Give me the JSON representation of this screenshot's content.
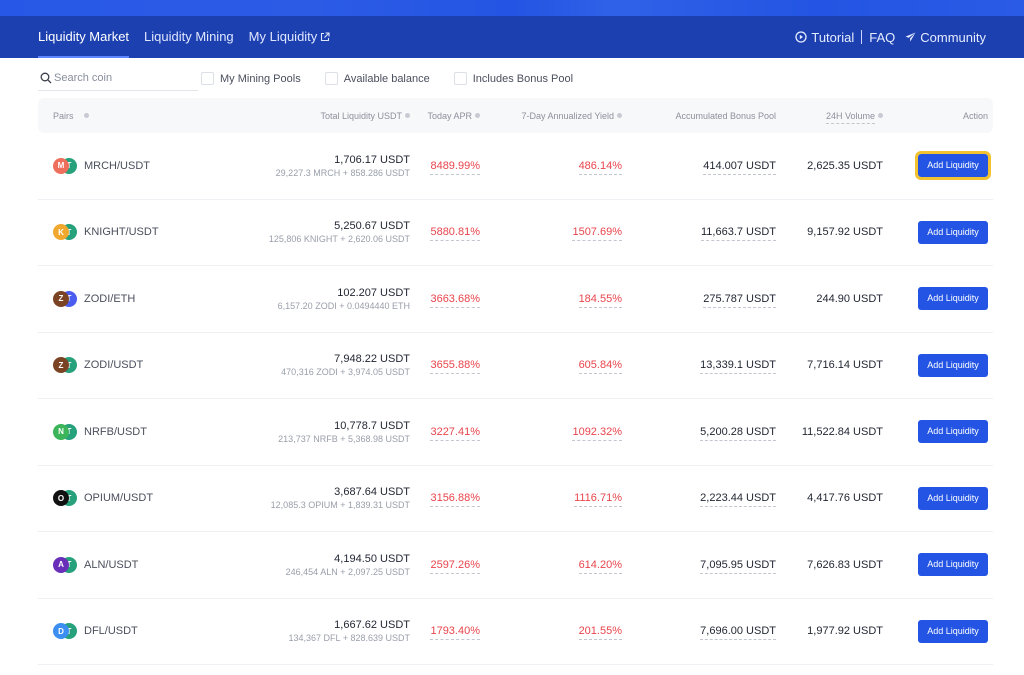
{
  "nav": {
    "items": [
      {
        "label": "Liquidity Market",
        "active": true
      },
      {
        "label": "Liquidity Mining",
        "active": false
      },
      {
        "label": "My Liquidity",
        "active": false,
        "icon": "external-link-icon"
      }
    ],
    "right": {
      "tutorial": "Tutorial",
      "faq": "FAQ",
      "community": "Community"
    }
  },
  "filters": {
    "search_placeholder": "Search coin",
    "search_value": "",
    "checkboxes": [
      {
        "label": "My Mining Pools",
        "checked": false
      },
      {
        "label": "Available balance",
        "checked": false
      },
      {
        "label": "Includes Bonus Pool",
        "checked": false
      }
    ]
  },
  "table": {
    "headers": {
      "pairs": "Pairs",
      "total_liquidity": "Total Liquidity USDT",
      "today_apr": "Today APR",
      "yield7d": "7-Day Annualized Yield",
      "bonus_pool": "Accumulated Bonus Pool",
      "volume24h": "24H Volume",
      "action": "Action"
    },
    "rows": [
      {
        "pair": "MRCH/USDT",
        "base_color": "#ef6f5d",
        "quote_color": "#26a17b",
        "liquidity": "1,706.17 USDT",
        "composition": "29,227.3 MRCH + 858.286 USDT",
        "apr": "8489.99%",
        "yield7d": "486.14%",
        "bonus": "414.007 USDT",
        "volume": "2,625.35 USDT",
        "action": "Add Liquidity",
        "focused": true
      },
      {
        "pair": "KNIGHT/USDT",
        "base_color": "#f0a92e",
        "quote_color": "#26a17b",
        "liquidity": "5,250.67 USDT",
        "composition": "125,806 KNIGHT + 2,620.06 USDT",
        "apr": "5880.81%",
        "yield7d": "1507.69%",
        "bonus": "11,663.7 USDT",
        "volume": "9,157.92 USDT",
        "action": "Add Liquidity",
        "focused": false
      },
      {
        "pair": "ZODI/ETH",
        "base_color": "#7a4424",
        "quote_color": "#4a5df0",
        "liquidity": "102.207 USDT",
        "composition": "6,157.20 ZODI + 0.0494440 ETH",
        "apr": "3663.68%",
        "yield7d": "184.55%",
        "bonus": "275.787 USDT",
        "volume": "244.90 USDT",
        "action": "Add Liquidity",
        "focused": false
      },
      {
        "pair": "ZODI/USDT",
        "base_color": "#7a4424",
        "quote_color": "#26a17b",
        "liquidity": "7,948.22 USDT",
        "composition": "470,316 ZODI + 3,974.05 USDT",
        "apr": "3655.88%",
        "yield7d": "605.84%",
        "bonus": "13,339.1 USDT",
        "volume": "7,716.14 USDT",
        "action": "Add Liquidity",
        "focused": false
      },
      {
        "pair": "NRFB/USDT",
        "base_color": "#3cb45a",
        "quote_color": "#26a17b",
        "liquidity": "10,778.7 USDT",
        "composition": "213,737 NRFB + 5,368.98 USDT",
        "apr": "3227.41%",
        "yield7d": "1092.32%",
        "bonus": "5,200.28 USDT",
        "volume": "11,522.84 USDT",
        "action": "Add Liquidity",
        "focused": false
      },
      {
        "pair": "OPIUM/USDT",
        "base_color": "#111111",
        "quote_color": "#26a17b",
        "liquidity": "3,687.64 USDT",
        "composition": "12,085.3 OPIUM + 1,839.31 USDT",
        "apr": "3156.88%",
        "yield7d": "1116.71%",
        "bonus": "2,223.44 USDT",
        "volume": "4,417.76 USDT",
        "action": "Add Liquidity",
        "focused": false
      },
      {
        "pair": "ALN/USDT",
        "base_color": "#6a2fb8",
        "quote_color": "#26a17b",
        "liquidity": "4,194.50 USDT",
        "composition": "246,454 ALN + 2,097.25 USDT",
        "apr": "2597.26%",
        "yield7d": "614.20%",
        "bonus": "7,095.95 USDT",
        "volume": "7,626.83 USDT",
        "action": "Add Liquidity",
        "focused": false
      },
      {
        "pair": "DFL/USDT",
        "base_color": "#3c8ef0",
        "quote_color": "#26a17b",
        "liquidity": "1,667.62 USDT",
        "composition": "134,367 DFL + 828.639 USDT",
        "apr": "1793.40%",
        "yield7d": "201.55%",
        "bonus": "7,696.00 USDT",
        "volume": "1,977.92 USDT",
        "action": "Add Liquidity",
        "focused": false
      }
    ]
  },
  "colors": {
    "brand_blue": "#2354e3",
    "nav_bg": "#1c40b0",
    "negative_red": "#e8454c",
    "focus_yellow": "#f2c230"
  }
}
